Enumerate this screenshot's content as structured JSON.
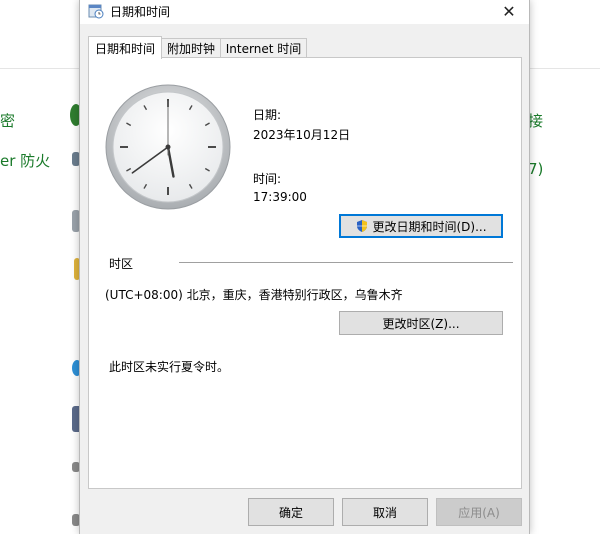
{
  "background": {
    "texts": [
      "密",
      "er 防火",
      "接",
      "7)"
    ]
  },
  "dialog": {
    "title": "日期和时间",
    "close_glyph": "✕",
    "tabs": [
      {
        "label": "日期和时间",
        "active": true
      },
      {
        "label": "附加时钟",
        "active": false
      },
      {
        "label": "Internet 时间",
        "active": false
      }
    ],
    "date_label": "日期:",
    "date_value": "2023年10月12日",
    "time_label": "时间:",
    "time_value": "17:39:00",
    "change_datetime_button": "更改日期和时间(D)...",
    "timezone_heading": "时区",
    "timezone_value": "(UTC+08:00) 北京，重庆，香港特别行政区，乌鲁木齐",
    "change_timezone_button": "更改时区(Z)...",
    "dst_note": "此时区未实行夏令时。",
    "ok_button": "确定",
    "cancel_button": "取消",
    "apply_button": "应用(A)",
    "apply_enabled": false,
    "clock_time": {
      "hour": 17,
      "minute": 39,
      "second": 0
    }
  },
  "colors": {
    "accent": "#0078d7",
    "bg_link_green": "#1a7a2a"
  }
}
